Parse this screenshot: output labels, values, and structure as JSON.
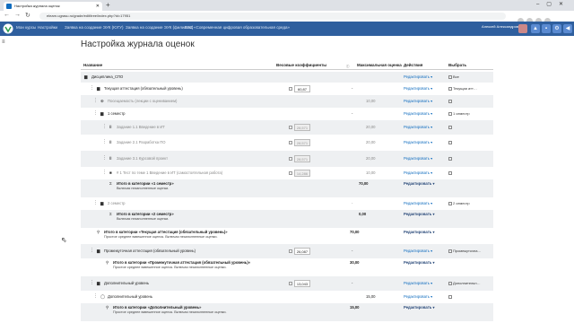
{
  "browser": {
    "tab_title": "Настройка журнала оценок",
    "url": "elearn.ugrasu.ru/grade/edit/tree/index.php?id=17951"
  },
  "topbar": {
    "menu": [
      "Мои курсы",
      "Настройки",
      "Заявка на создание ЭУК (ЮГУ)",
      "Заявка на создание ЭУК (филиалы)",
      "ГИС «Современная цифровая образовательная среда»"
    ],
    "user": "Алексей Александров"
  },
  "page": {
    "title": "Настройка журнала оценок"
  },
  "table": {
    "headers": {
      "name": "Название",
      "weights": "Весовые коэффициенты",
      "max": "Максимальная оценка",
      "actions": "Действия",
      "select": "Выбрать"
    },
    "edit_label": "Редактировать ▾",
    "rows": [
      {
        "name": "Дисциплина_СПО",
        "max": "",
        "weight": "",
        "select": "Все",
        "shade": true
      },
      {
        "name": "Текущая аттестация (обязательный уровень)",
        "max": "-",
        "weight": "60,87",
        "select": "Текущая атт…",
        "shade": false
      },
      {
        "name": "Посещаемость (лекции с оцениванием)",
        "max": "10,00",
        "weight": "",
        "select": "",
        "shade": true
      },
      {
        "name": "1 семестр",
        "max": "-",
        "weight": "",
        "select": "1 семестр",
        "shade": false
      },
      {
        "name": "Задание 1.1 Введение в ИТ",
        "max": "20,00",
        "weight": "28,571",
        "select": "",
        "shade": true
      },
      {
        "name": "Задание 2.1 Разработка ПО",
        "max": "20,00",
        "weight": "28,571",
        "select": "",
        "shade": false
      },
      {
        "name": "Задание 3.1 Курсовой проект",
        "max": "20,00",
        "weight": "28,571",
        "select": "",
        "shade": true
      },
      {
        "name": "# 1 Тест по теме 1 Введение в ИТ (самостоятельная работа)",
        "max": "10,00",
        "weight": "14,286",
        "select": "",
        "shade": false
      },
      {
        "name": "Итого в категории «1 семестр»",
        "sub": "Включая незаполненные оценки.",
        "max": "70,00",
        "weight": "",
        "select": "",
        "shade": true
      },
      {
        "name": "2 семестр",
        "max": "-",
        "weight": "",
        "select": "2 семестр",
        "shade": false
      },
      {
        "name": "Итого в категории «2 семестр»",
        "sub": "Включая незаполненные оценки.",
        "max": "0,00",
        "weight": "",
        "select": "",
        "shade": true
      },
      {
        "name": "Итого в категории «Текущая аттестация (обязательный уровень)»",
        "sub": "Простое среднее взвешенное оценок. Включая незаполненные оценки.",
        "max": "70,00",
        "weight": "",
        "select": "",
        "shade": false
      },
      {
        "name": "Промежуточная аттестация (обязательный уровень)",
        "max": "-",
        "weight": "26,087",
        "select": "Промежуточна…",
        "shade": true
      },
      {
        "name": "Итого в категории «Промежуточная аттестация (обязательный уровень)»",
        "sub": "Простое среднее взвешенное оценок. Включая незаполненные оценки.",
        "max": "30,00",
        "weight": "",
        "select": "",
        "shade": false
      },
      {
        "name": "Дополнительный уровень",
        "max": "-",
        "weight": "13,043",
        "select": "Дополнительн…",
        "shade": true
      },
      {
        "name": "Дополнительный уровень",
        "max": "15,00",
        "weight": "",
        "select": "",
        "shade": false
      },
      {
        "name": "Итого в категории «Дополнительный уровень»",
        "sub": "Простое среднее взвешенное оценок. Включая незаполненные оценки.",
        "max": "15,00",
        "weight": "",
        "select": "",
        "shade": true
      }
    ]
  }
}
